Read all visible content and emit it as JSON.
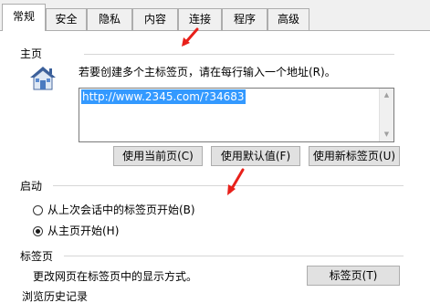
{
  "tabs": [
    {
      "label": "常规",
      "active": true
    },
    {
      "label": "安全",
      "active": false
    },
    {
      "label": "隐私",
      "active": false
    },
    {
      "label": "内容",
      "active": false
    },
    {
      "label": "连接",
      "active": false
    },
    {
      "label": "程序",
      "active": false
    },
    {
      "label": "高级",
      "active": false
    }
  ],
  "homepage": {
    "group_label": "主页",
    "hint": "若要创建多个主标签页，请在每行输入一个地址(R)。",
    "url_value": "http://www.2345.com/?34683",
    "buttons": {
      "use_current": "使用当前页(C)",
      "use_default": "使用默认值(F)",
      "use_new_tab": "使用新标签页(U)"
    }
  },
  "startup": {
    "group_label": "启动",
    "options": [
      {
        "label": "从上次会话中的标签页开始(B)",
        "checked": false
      },
      {
        "label": "从主页开始(H)",
        "checked": true
      }
    ]
  },
  "tabs_group": {
    "group_label": "标签页",
    "description": "更改网页在标签页中的显示方式。",
    "button": "标签页(T)"
  },
  "history_group": {
    "group_label": "浏览历史记录"
  },
  "annotations": {
    "arrow_color": "#e8201a"
  }
}
